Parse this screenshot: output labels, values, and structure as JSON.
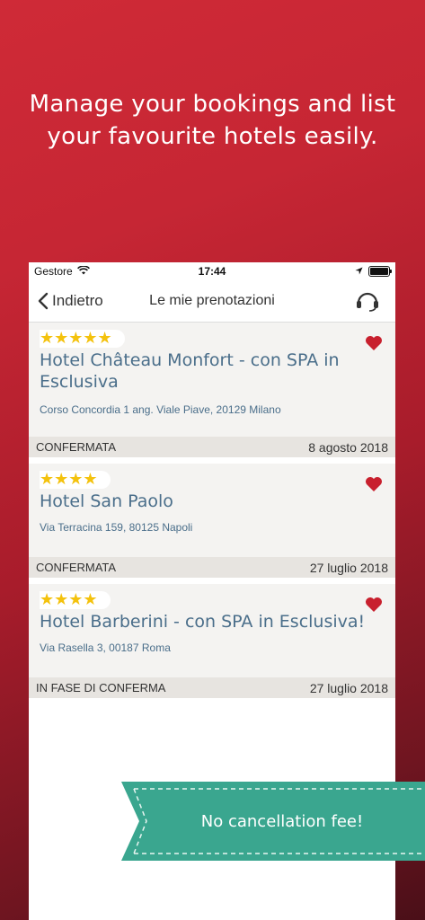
{
  "headline": {
    "line1": "Manage your bookings and list",
    "line2": "your favourite hotels easily."
  },
  "status_bar": {
    "carrier": "Gestore",
    "time": "17:44"
  },
  "navbar": {
    "back_label": "Indietro",
    "title": "Le mie prenotazioni"
  },
  "bookings": [
    {
      "stars": "★★★★★",
      "name": "Hotel Château Monfort - con SPA in Esclusiva",
      "address": "Corso Concordia 1 ang. Viale Piave, 20129 Milano",
      "status": "CONFERMATA",
      "date": "8 agosto 2018"
    },
    {
      "stars": "★★★★",
      "name": "Hotel San Paolo",
      "address": "Via Terracina 159, 80125 Napoli",
      "status": "CONFERMATA",
      "date": "27 luglio 2018"
    },
    {
      "stars": "★★★★",
      "name": "Hotel Barberini - con SPA in Esclusiva!",
      "address": "Via Rasella 3, 00187 Roma",
      "status": "IN FASE DI CONFERMA",
      "date": "27 luglio 2018"
    }
  ],
  "banner": {
    "text": "No cancellation fee!"
  },
  "colors": {
    "brand_red": "#c62634",
    "star": "#f4c20d",
    "hotel_text": "#4a6e8a",
    "heart": "#c8202e",
    "banner": "#3aa68f"
  },
  "icons": {
    "back": "chevron-left-icon",
    "support": "headset-icon",
    "favourite": "heart-icon",
    "wifi": "wifi-icon",
    "location": "location-arrow-icon",
    "battery": "battery-icon"
  }
}
